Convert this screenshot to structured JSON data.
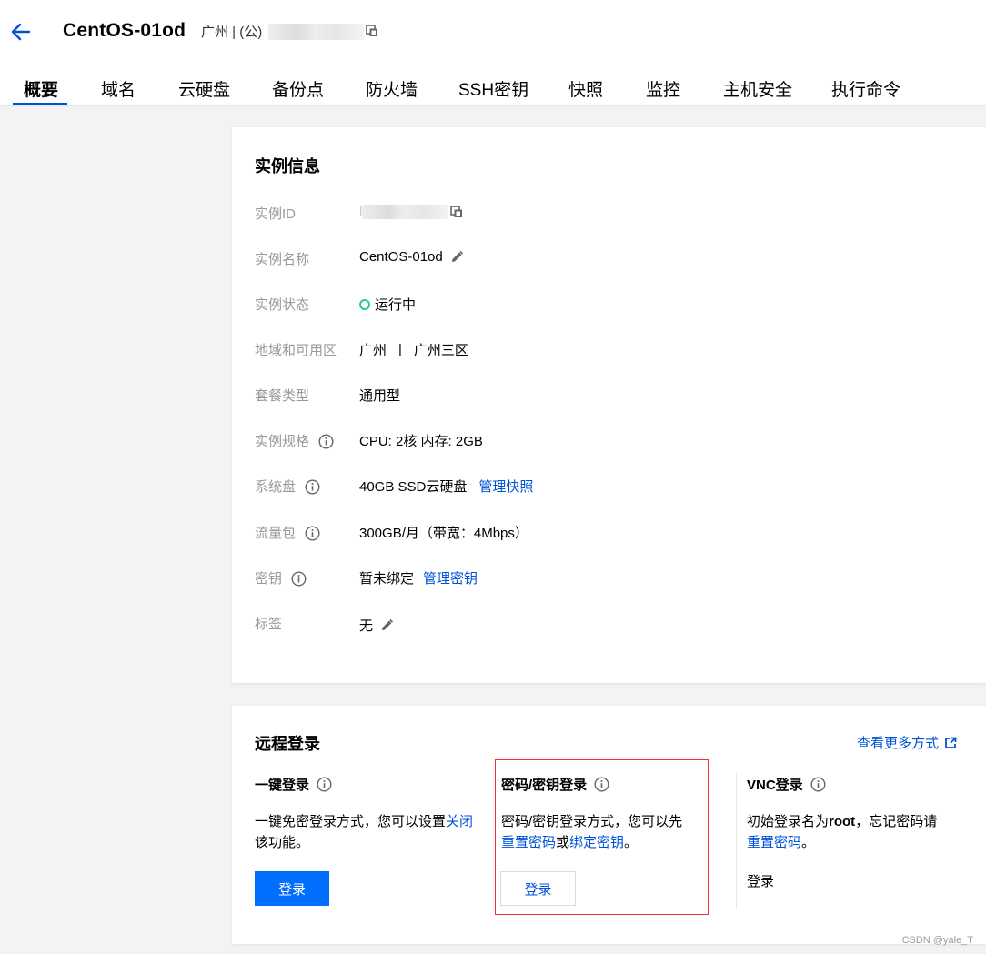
{
  "header": {
    "title": "CentOS-01od",
    "region": "广州 | (公) "
  },
  "tabs": [
    {
      "label": "概要"
    },
    {
      "label": "域名"
    },
    {
      "label": "云硬盘"
    },
    {
      "label": "备份点"
    },
    {
      "label": "防火墙"
    },
    {
      "label": "SSH密钥"
    },
    {
      "label": "快照"
    },
    {
      "label": "监控"
    },
    {
      "label": "主机安全"
    },
    {
      "label": "执行命令"
    }
  ],
  "instance_info": {
    "title": "实例信息",
    "id_label": "实例ID",
    "id_prefix": "l",
    "name_label": "实例名称",
    "name_value": "CentOS-01od",
    "status_label": "实例状态",
    "status_value": "运行中",
    "status_color": "#29cc85",
    "region_label": "地域和可用区",
    "region_value": "广州",
    "region_sep": "|",
    "zone_value": "广州三区",
    "package_label": "套餐类型",
    "package_value": "通用型",
    "spec_label": "实例规格",
    "spec_value": "CPU: 2核 内存: 2GB",
    "disk_label": "系统盘",
    "disk_value": "40GB SSD云硬盘",
    "disk_link": "管理快照",
    "traffic_label": "流量包",
    "traffic_value": "300GB/月（带宽：4Mbps）",
    "key_label": "密钥",
    "key_value": "暂未绑定",
    "key_link": "管理密钥",
    "tag_label": "标签",
    "tag_value": "无"
  },
  "remote_login": {
    "title": "远程登录",
    "more_link": "查看更多方式",
    "one_click": {
      "title": "一键登录",
      "desc_1": "一键免密登录方式，您可以设置",
      "desc_link": "关闭",
      "desc_2": "该功能。",
      "button": "登录"
    },
    "password": {
      "title": "密码/密钥登录",
      "desc_1": "密码/密钥登录方式，您可以先",
      "link_reset": "重置密码",
      "or": "或",
      "link_bind": "绑定密钥",
      "period": "。",
      "button": "登录"
    },
    "vnc": {
      "title": "VNC登录",
      "desc_1": "初始登录名为",
      "root": "root",
      "desc_2": "，忘记密码请",
      "link_reset": "重置密码",
      "period": "。",
      "login_link": "登录"
    }
  },
  "watermark": "CSDN @yale_T",
  "colors": {
    "primary": "#006eff",
    "link": "#0052d9",
    "highlight": "#e33333"
  }
}
